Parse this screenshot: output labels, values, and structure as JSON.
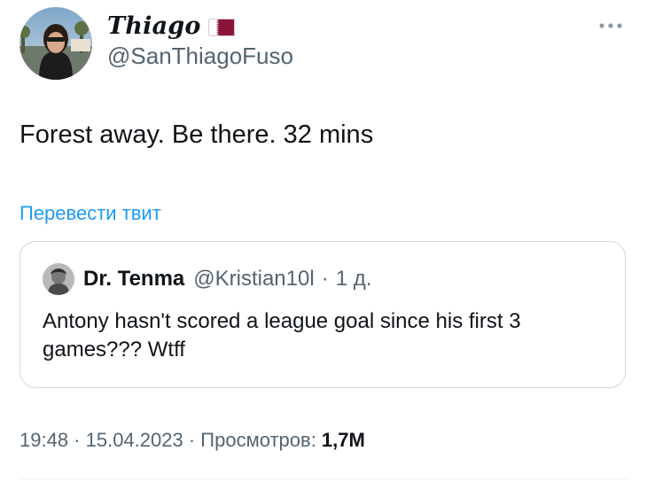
{
  "author": {
    "display_name": "Thiago",
    "flag": "qatar-flag-icon",
    "handle": "@SanThiagoFuso",
    "avatar": "avatar-photo"
  },
  "tweet": {
    "text": "Forest away. Be there. 32 mins",
    "translate_label": "Перевести твит"
  },
  "quote": {
    "display_name": "Dr. Tenma",
    "handle": "@Kristian10l",
    "separator": "·",
    "time": "1 д.",
    "text": "Antony hasn't scored a league goal since his first 3 games??? Wtff"
  },
  "meta": {
    "time": "19:48",
    "separator1": " · ",
    "date": "15.04.2023",
    "separator2": " · ",
    "views_label": "Просмотров: ",
    "views_count": "1,7M"
  },
  "colors": {
    "accent": "#1d9bf0",
    "secondary_text": "#536471",
    "primary_text": "#0f1419",
    "border": "#cfd9de",
    "flag_maroon": "#8a1538"
  }
}
